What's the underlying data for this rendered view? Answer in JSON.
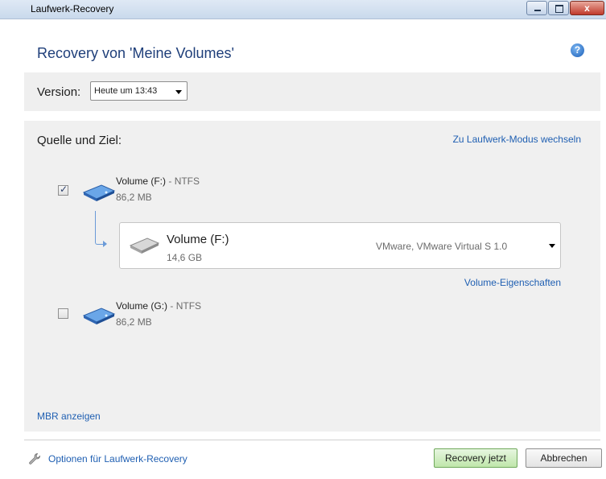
{
  "window": {
    "title": "Laufwerk-Recovery",
    "close_glyph": "x"
  },
  "header": {
    "title": "Recovery von 'Meine Volumes'",
    "help_glyph": "?"
  },
  "version": {
    "label": "Version:",
    "selected": "Heute um 13:43"
  },
  "main": {
    "section_title": "Quelle und Ziel:",
    "mode_link": "Zu Laufwerk-Modus wechseln",
    "volumes": [
      {
        "name": "Volume (F:)",
        "fs": "- NTFS",
        "size": "86,2 MB",
        "checked": true
      },
      {
        "name": "Volume (G:)",
        "fs": "- NTFS",
        "size": "86,2 MB",
        "checked": false
      }
    ],
    "target": {
      "name": "Volume (F:)",
      "size": "14,6 GB",
      "device": "VMware, VMware Virtual S 1.0"
    },
    "properties_link": "Volume-Eigenschaften",
    "mbr_link": "MBR anzeigen"
  },
  "footer": {
    "options_link": "Optionen für Laufwerk-Recovery",
    "recover_button": "Recovery jetzt",
    "cancel_button": "Abbrechen"
  },
  "icons": [
    "blue-drive-icon",
    "gray-drive-icon",
    "help-icon",
    "wrench-icon"
  ],
  "colors": {
    "link": "#1f5fb2",
    "title": "#1f3f7a",
    "recover_button": "#bfe6aa"
  }
}
